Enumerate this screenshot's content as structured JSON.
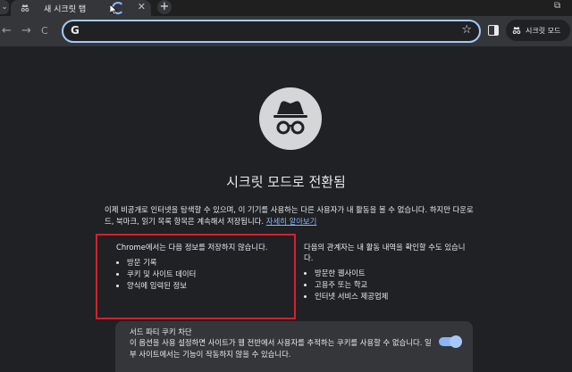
{
  "tab": {
    "title": "새 시크릿 탭",
    "close": "✕"
  },
  "tabstrip": {
    "new_tab": "+",
    "tab_list": "⌄"
  },
  "window": {
    "restore": "⧉"
  },
  "toolbar": {
    "back": "←",
    "forward": "→",
    "reload": "C",
    "g_logo": "G",
    "bookmark": "☆",
    "incognito_label": "시크릿 모드"
  },
  "omnibox": {
    "value": ""
  },
  "page": {
    "heading": "시크릿 모드로 전환됨",
    "intro": "이제 비공개로 인터넷을 탐색할 수 있으며, 이 기기를 사용하는 다른 사용자가 내 활동을 볼 수 없습니다. 하지만 다운로드, 북마크, 읽기 목록 항목은 계속해서 저장됩니다.",
    "learn_more": "자세히 알아보기",
    "left_title": "Chrome에서는 다음 정보를 저장하지 않습니다.",
    "left_items": [
      "방문 기록",
      "쿠키 및 사이트 데이터",
      "양식에 입력된 정보"
    ],
    "right_title": "다음의 관계자는 내 활동 내역을 확인할 수도 있습니다.",
    "right_items": [
      "방문한 웹사이트",
      "고용주 또는 학교",
      "인터넷 서비스 제공업체"
    ]
  },
  "card": {
    "title": "서드 파티 쿠키 차단",
    "desc": "이 옵션을 사용 설정하면 사이트가 웹 전반에서 사용자를 추적하는 쿠키를 사용할 수 없습니다. 일부 사이트에서는 기능이 작동하지 않을 수 있습니다.",
    "toggle_on": true
  },
  "colors": {
    "accent": "#8ab4f8",
    "highlight": "#d3202f",
    "bg": "#202124"
  }
}
